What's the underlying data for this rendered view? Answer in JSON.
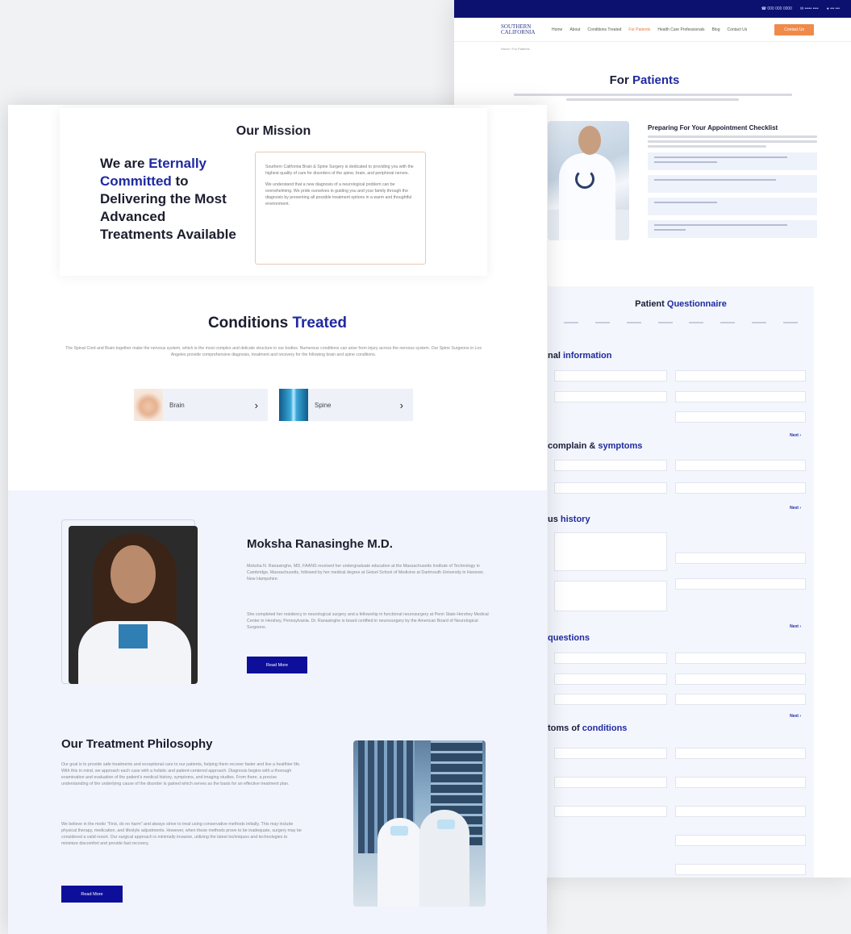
{
  "back_page": {
    "topbar": {
      "phone": "☎ 000 000 0000",
      "email": "✉ ••••• ••••",
      "login": "● •••  •••"
    },
    "nav": {
      "logo": "SOUTHERN CALIFORNIA",
      "items": [
        "Home",
        "About",
        "Conditions Treated",
        "For Patients",
        "Health Care Professionals",
        "Blog",
        "Contact Us"
      ],
      "active_index": 3,
      "cta": "Contact Us"
    },
    "breadcrumb": "Home / For Patients",
    "title_prefix": "For",
    "title_highlight": "Patients",
    "checklist": {
      "title": "Preparing For Your Appointment Checklist"
    },
    "questionnaire": {
      "title_prefix": "Patient",
      "title_highlight": "Questionnaire",
      "sections": [
        {
          "prefix": "nal",
          "highlight": "information"
        },
        {
          "prefix": "complain &",
          "highlight": "symptoms"
        },
        {
          "prefix": "us",
          "highlight": "history"
        },
        {
          "prefix": "",
          "highlight": "questions"
        },
        {
          "prefix": "toms of",
          "highlight": "conditions"
        }
      ],
      "next_label": "Next ›"
    }
  },
  "front_page": {
    "mission": {
      "title": "Our Mission",
      "headline_1": "We are",
      "headline_highlight": "Eternally Committed",
      "headline_2": "to Delivering the Most Advanced Treatments Available",
      "para_1": "Southern California Brain & Spine Surgery is dedicated to providing you with the highest quality of care for disorders of the spine, brain, and peripheral nerves.",
      "para_2": "We understand that a new diagnosis of a neurological problem can be overwhelming. We pride ourselves in guiding you and your family through the diagnosis by presenting all possible treatment options in a warm and thoughtful environment."
    },
    "conditions": {
      "title_prefix": "Conditions",
      "title_highlight": "Treated",
      "description": "The Spinal Cord and Brain together make the nervous system, which is the most complex and delicate structure in our bodies. Numerous conditions can arise from injury across the nervous system. Our Spine Surgeons in Los Angeles provide comprehensive diagnosis, treatment and recovery for the following brain and spine conditions.",
      "cards": [
        {
          "label": "Brain",
          "icon": "chevron-right-icon"
        },
        {
          "label": "Spine",
          "icon": "chevron-right-icon"
        }
      ]
    },
    "doctor": {
      "name": "Moksha Ranasinghe M.D.",
      "para_1": "Moksha N. Ranasinghe, MD, FAANS received her undergraduate education at the Massachusetts Institute of Technology in Cambridge, Massachusetts, followed by her medical degree at Geisel School of Medicine at Dartmouth University in Hanover, New Hampshire.",
      "para_2": "She completed her residency in neurological surgery and a fellowship in functional neurosurgery at Penn State Hershey Medical Center in Hershey, Pennsylvania. Dr. Ranasinghe is board certified in neurosurgery by the American Board of Neurological Surgeons.",
      "button": "Read More"
    },
    "philosophy": {
      "title": "Our Treatment Philosophy",
      "para_1": "Our goal is to provide safe treatments and exceptional care to our patients, helping them recover faster and live a healthier life. With this in mind, we approach each case with a holistic and patient-centered approach. Diagnosis begins with a thorough examination and evaluation of the patient's medical history, symptoms, and imaging studies. From there, a precise understanding of the underlying cause of the disorder is gained which serves as the basis for an effective treatment plan.",
      "para_2": "We believe in the motto \"First, do no harm\" and always strive to treat using conservative methods initially. This may include physical therapy, medication, and lifestyle adjustments. However, when these methods prove to be inadequate, surgery may be considered a valid resort. Our surgical approach is minimally invasive, utilizing the latest techniques and technologies to minimize discomfort and provide fast recovery.",
      "button": "Read More"
    }
  },
  "colors": {
    "navy": "#1f2aa0",
    "topbar": "#0c1170",
    "button": "#0d0f9a",
    "cta_orange": "#f08a4b"
  }
}
